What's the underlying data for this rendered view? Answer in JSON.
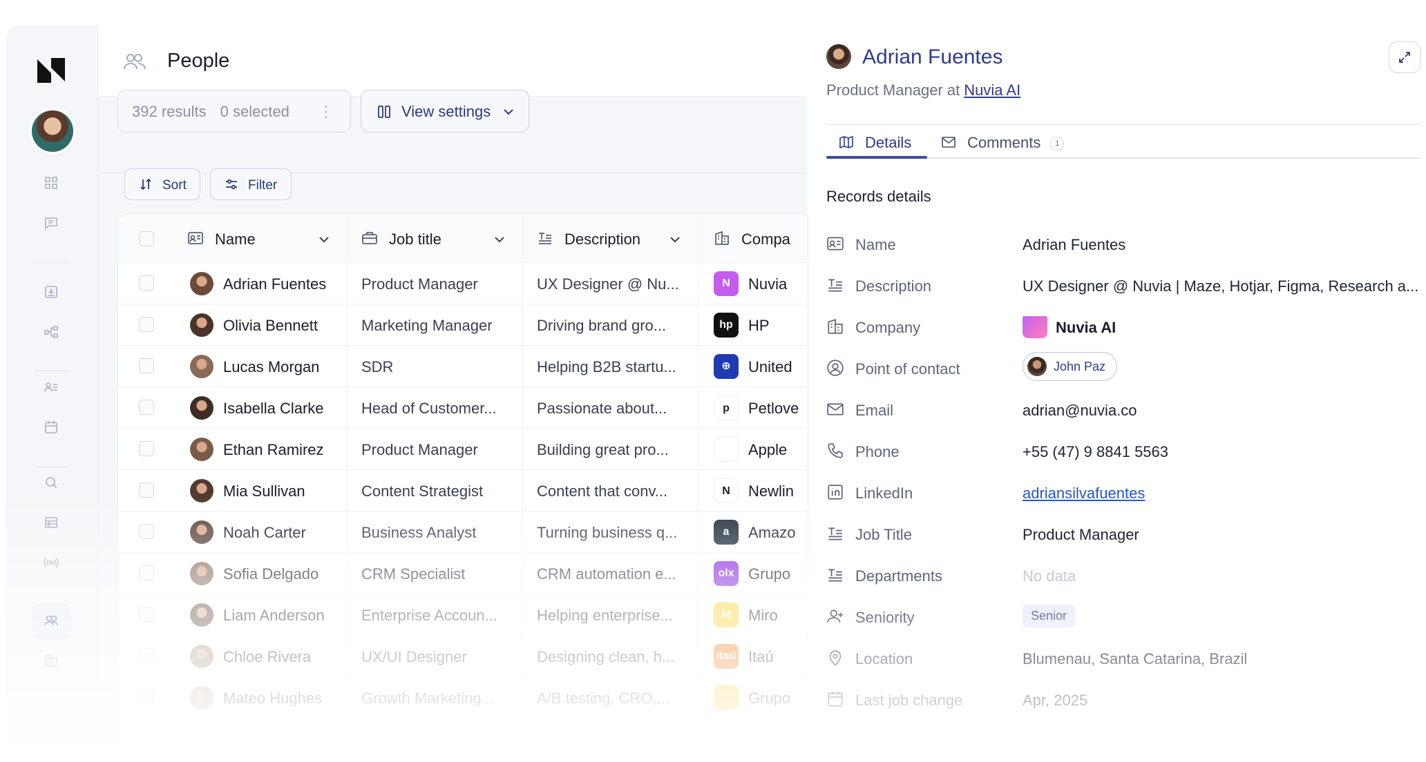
{
  "header": {
    "title": "People"
  },
  "toolbar": {
    "results": "392 results",
    "selected": "0 selected",
    "menu_dots": "⋮",
    "view_settings": "View settings",
    "sort": "Sort",
    "filter": "Filter"
  },
  "table": {
    "columns": [
      "Name",
      "Job title",
      "Description",
      "Compa"
    ],
    "rows": [
      {
        "name": "Adrian Fuentes",
        "job": "Product Manager",
        "desc": "UX Designer @ Nu...",
        "company": "Nuvia",
        "logo_color": "#c45cf0",
        "logo": "N"
      },
      {
        "name": "Olivia Bennett",
        "job": "Marketing Manager",
        "desc": "Driving brand gro...",
        "company": "HP",
        "logo_color": "#111111",
        "logo": "hp"
      },
      {
        "name": "Lucas Morgan",
        "job": "SDR",
        "desc": "Helping B2B startu...",
        "company": "United",
        "logo_color": "#1f3bb3",
        "logo": "⊕"
      },
      {
        "name": "Isabella Clarke",
        "job": "Head of Customer...",
        "desc": "Passionate about...",
        "company": "Petlove",
        "logo_color": "#ffffff",
        "logo": "p"
      },
      {
        "name": "Ethan Ramirez",
        "job": "Product Manager",
        "desc": "Building great pro...",
        "company": "Apple",
        "logo_color": "#ffffff",
        "logo": ""
      },
      {
        "name": "Mia Sullivan",
        "job": "Content Strategist",
        "desc": "Content that conv...",
        "company": "Newlin",
        "logo_color": "#ffffff",
        "logo": "N"
      },
      {
        "name": "Noah Carter",
        "job": "Business Analyst",
        "desc": "Turning business q...",
        "company": "Amazo",
        "logo_color": "#232f3e",
        "logo": "a"
      },
      {
        "name": "Sofia Delgado",
        "job": "CRM Specialist",
        "desc": "CRM automation e...",
        "company": "Grupo",
        "logo_color": "#8a2be2",
        "logo": "olx"
      },
      {
        "name": "Liam Anderson",
        "job": "Enterprise Accoun...",
        "desc": "Helping enterprise...",
        "company": "Miro",
        "logo_color": "#ffd02f",
        "logo": "M"
      },
      {
        "name": "Chloe Rivera",
        "job": "UX/UI Designer",
        "desc": "Designing clean, h...",
        "company": "Itaú",
        "logo_color": "#ec7000",
        "logo": "itaú"
      },
      {
        "name": "Mateo Hughes",
        "job": "Growth Marketing...",
        "desc": "A/B testing, CRO,...",
        "company": "Grupo",
        "logo_color": "#f0c000",
        "logo": ""
      }
    ]
  },
  "panel": {
    "name": "Adrian Fuentes",
    "role": "Product Manager",
    "at": "at",
    "company_link": "Nuvia AI",
    "tabs": {
      "details": "Details",
      "comments": "Comments",
      "comments_count": "1"
    },
    "section_title": "Records details",
    "fields": {
      "name_label": "Name",
      "name_value": "Adrian Fuentes",
      "description_label": "Description",
      "description_value": "UX Designer @ Nuvia | Maze, Hotjar, Figma, Research a...",
      "company_label": "Company",
      "company_value": "Nuvia AI",
      "contact_label": "Point of contact",
      "contact_value": "John Paz",
      "email_label": "Email",
      "email_value": "adrian@nuvia.co",
      "phone_label": "Phone",
      "phone_value": "+55 (47) 9 8841 5563",
      "linkedin_label": "LinkedIn",
      "linkedin_value": "adriansilvafuentes",
      "jobtitle_label": "Job Title",
      "jobtitle_value": "Product Manager",
      "departments_label": "Departments",
      "departments_value": "No data",
      "seniority_label": "Seniority",
      "seniority_value": "Senior",
      "location_label": "Location",
      "location_value": "Blumenau, Santa Catarina, Brazil",
      "lastjob_label": "Last job change",
      "lastjob_value": "Apr, 2025"
    }
  }
}
